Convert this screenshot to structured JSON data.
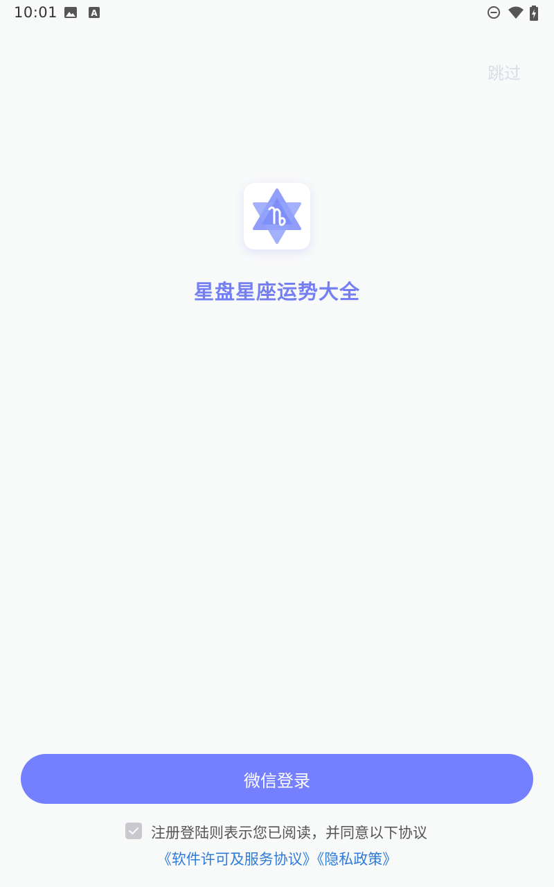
{
  "status_bar": {
    "time": "10:01",
    "left_icons": [
      "image-icon",
      "font-a-icon"
    ],
    "right_icons": [
      "do-not-disturb-icon",
      "wifi-icon",
      "battery-charging-icon"
    ]
  },
  "header": {
    "skip_label": "跳过"
  },
  "app": {
    "logo_icon": "star-capricorn-icon",
    "title": "星盘星座运势大全"
  },
  "login": {
    "wechat_label": "微信登录"
  },
  "agreement": {
    "checked": true,
    "text": "注册登陆则表示您已阅读，并同意以下协议",
    "license_link": "《软件许可及服务协议》",
    "privacy_link": "《隐私政策》"
  },
  "colors": {
    "accent": "#7480ff",
    "title": "#747ff3",
    "link": "#2f7bd9",
    "background": "#f8f9f9"
  }
}
